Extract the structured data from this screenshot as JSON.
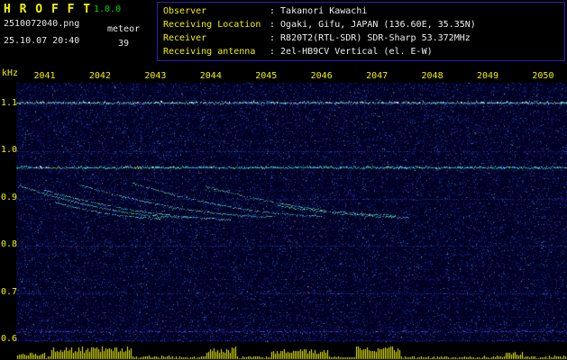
{
  "app": {
    "title": "H R O F F T",
    "version": "1.0.0",
    "filename": "2510072040.png",
    "mode": "meteor",
    "datetime": "25.10.07 20:40",
    "count": "39"
  },
  "info": {
    "rows": [
      {
        "label": "Observer",
        "value": ": Takanori Kawachi"
      },
      {
        "label": "Receiving Location",
        "value": ": Ogaki, Gifu, JAPAN (136.60E, 35.35N)"
      },
      {
        "label": "Receiver",
        "value": ": R820T2(RTL-SDR) SDR-Sharp 53.372MHz"
      },
      {
        "label": "Receiving antenna",
        "value": ": 2el-HB9CV Vertical (el. E-W)"
      }
    ]
  },
  "chart_data": {
    "type": "heatmap",
    "subtype": "radio-meteor-spectrogram",
    "title": "",
    "x_tick_labels": [
      "2041",
      "2042",
      "2043",
      "2044",
      "2045",
      "2046",
      "2047",
      "2048",
      "2049",
      "2050"
    ],
    "x_range_hhmm": [
      "20:40",
      "20:50"
    ],
    "y_axis_label": "kHz",
    "y_tick_labels": [
      "1.1",
      "1.0",
      "0.9",
      "0.8",
      "0.7",
      "0.6"
    ],
    "y_range_khz": [
      0.595,
      1.146
    ],
    "gridlines_khz": [
      1.1,
      1.0,
      0.9,
      0.8,
      0.7,
      0.6
    ],
    "colors": {
      "background": "#000024",
      "axis_text": "#f2f200",
      "noise_blue": "#2d4be1",
      "panel_border": "#2323b8"
    },
    "carriers": [
      {
        "freq_khz": 1.104,
        "color": "#7be8d8",
        "intensity": 0.95
      },
      {
        "freq_khz": 0.967,
        "color": "#35e8a8",
        "intensity": 1.0,
        "sparkle": true
      },
      {
        "freq_khz": 0.62,
        "color": "#6a4dff",
        "intensity": 0.5,
        "soft": true
      }
    ],
    "doppler_traces": [
      {
        "t0": 2040.55,
        "f0": 0.929,
        "t1": 2043.6,
        "f1": 0.861
      },
      {
        "t0": 2041.0,
        "f0": 0.919,
        "t1": 2044.35,
        "f1": 0.858
      },
      {
        "t0": 2041.65,
        "f0": 0.93,
        "t1": 2045.1,
        "f1": 0.863
      },
      {
        "t0": 2042.6,
        "f0": 0.934,
        "t1": 2046.0,
        "f1": 0.865
      },
      {
        "t0": 2043.9,
        "f0": 0.928,
        "t1": 2047.35,
        "f1": 0.866
      },
      {
        "t0": 2041.2,
        "f0": 0.893,
        "t1": 2043.1,
        "f1": 0.86
      },
      {
        "t0": 2045.2,
        "f0": 0.887,
        "t1": 2047.6,
        "f1": 0.862
      }
    ],
    "noise": {
      "seed": 7,
      "dots": 26000
    },
    "level_bar": {
      "color": "#f0f000",
      "baseline": 0.18,
      "bursts": [
        {
          "t0": 2040.53,
          "t1": 2041.02,
          "level": 0.45
        },
        {
          "t0": 2041.1,
          "t1": 2042.56,
          "level": 0.85
        },
        {
          "t0": 2043.9,
          "t1": 2044.46,
          "level": 0.8
        },
        {
          "t0": 2045.08,
          "t1": 2046.13,
          "level": 0.65
        },
        {
          "t0": 2046.62,
          "t1": 2047.43,
          "level": 0.85
        },
        {
          "t0": 2049.3,
          "t1": 2049.63,
          "level": 0.5
        }
      ]
    }
  }
}
